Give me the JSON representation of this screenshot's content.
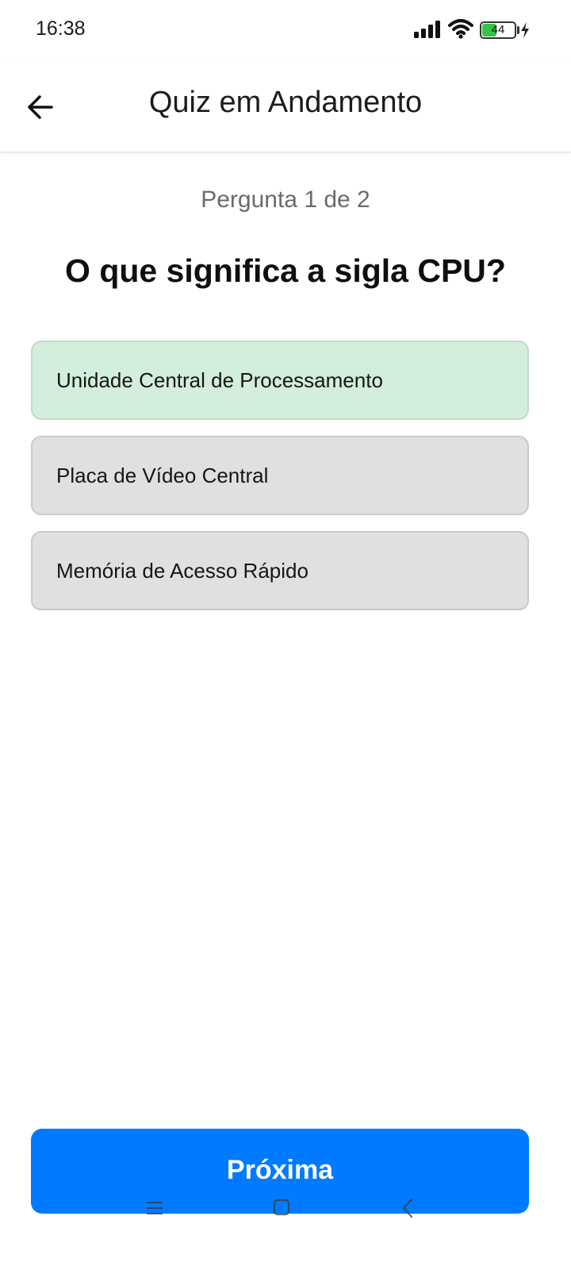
{
  "status_bar": {
    "time": "16:38",
    "battery_level": "44",
    "battery_fraction": 0.44,
    "icons": [
      "signal-icon",
      "wifi-icon",
      "battery-icon",
      "charging-bolt-icon"
    ]
  },
  "header": {
    "title": "Quiz em Andamento",
    "back_icon": "arrow-left-icon"
  },
  "quiz": {
    "progress": "Pergunta 1 de 2",
    "question": "O que significa a sigla CPU?",
    "options": [
      {
        "label": "Unidade Central de Processamento",
        "selected": true
      },
      {
        "label": "Placa de Vídeo Central",
        "selected": false
      },
      {
        "label": "Memória de Acesso Rápido",
        "selected": false
      }
    ],
    "next_label": "Próxima"
  },
  "nav_bar": {
    "icons": [
      "menu-icon",
      "home-icon",
      "back-icon"
    ]
  },
  "colors": {
    "primary": "#007bff",
    "selected_option_bg": "#d3eedb",
    "option_bg": "#e0e0e0",
    "battery_fill": "#35c24a"
  }
}
